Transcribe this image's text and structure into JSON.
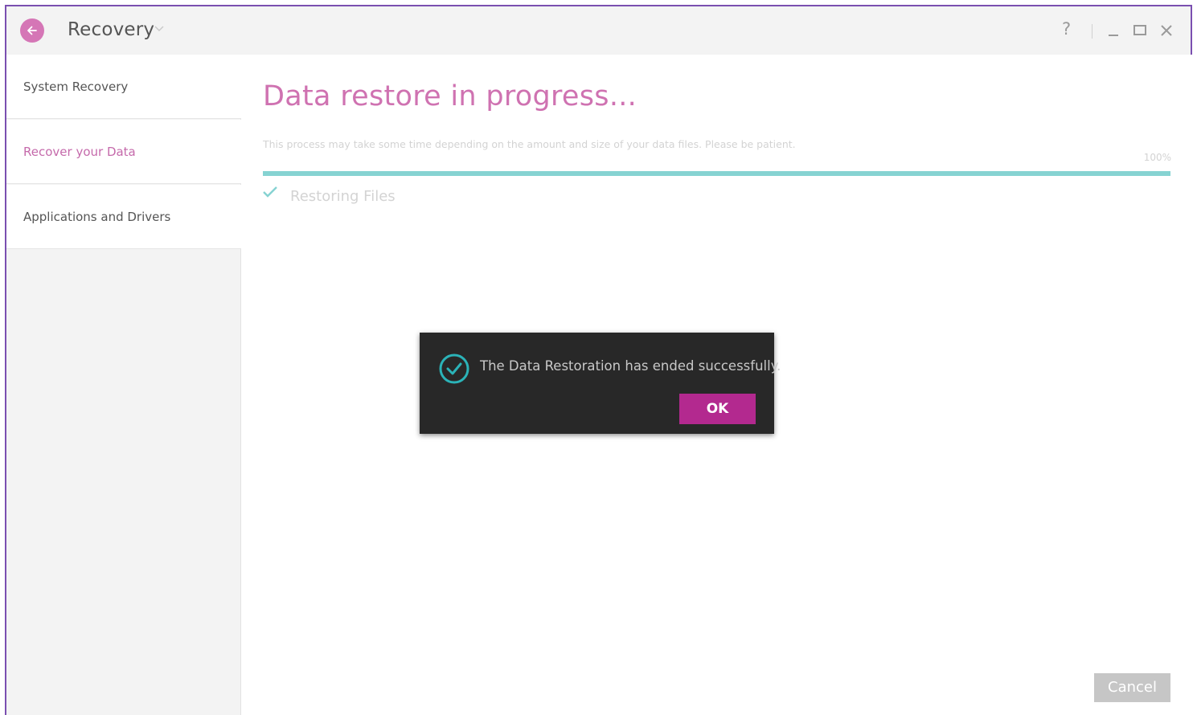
{
  "window": {
    "title": "Recovery",
    "accent_color": "#d576b6",
    "border_color": "#7a4fb0",
    "help_label": "?"
  },
  "titlebar_icons": [
    "back-arrow-icon",
    "chevron-down-icon",
    "minimize-icon",
    "maximize-icon",
    "close-icon"
  ],
  "sidebar": {
    "items": [
      {
        "label": "System Recovery",
        "active": false
      },
      {
        "label": "Recover your Data",
        "active": true
      },
      {
        "label": "Applications and Drivers",
        "active": false
      }
    ]
  },
  "main": {
    "heading": "Data restore in progress...",
    "description": "This process may take some time depending on the amount and size of your data files. Please be patient.",
    "progress": {
      "percent_label": "100%",
      "value": 1.0,
      "color": "#86d3d2"
    },
    "steps": [
      {
        "label": "Restoring Files",
        "done": true,
        "icon": "checkmark-icon"
      }
    ],
    "cancel_label": "Cancel"
  },
  "dialog": {
    "icon": "success-check-circle-icon",
    "message": "The Data Restoration has ended successfully.",
    "ok_label": "OK",
    "ok_color": "#b3298f"
  }
}
